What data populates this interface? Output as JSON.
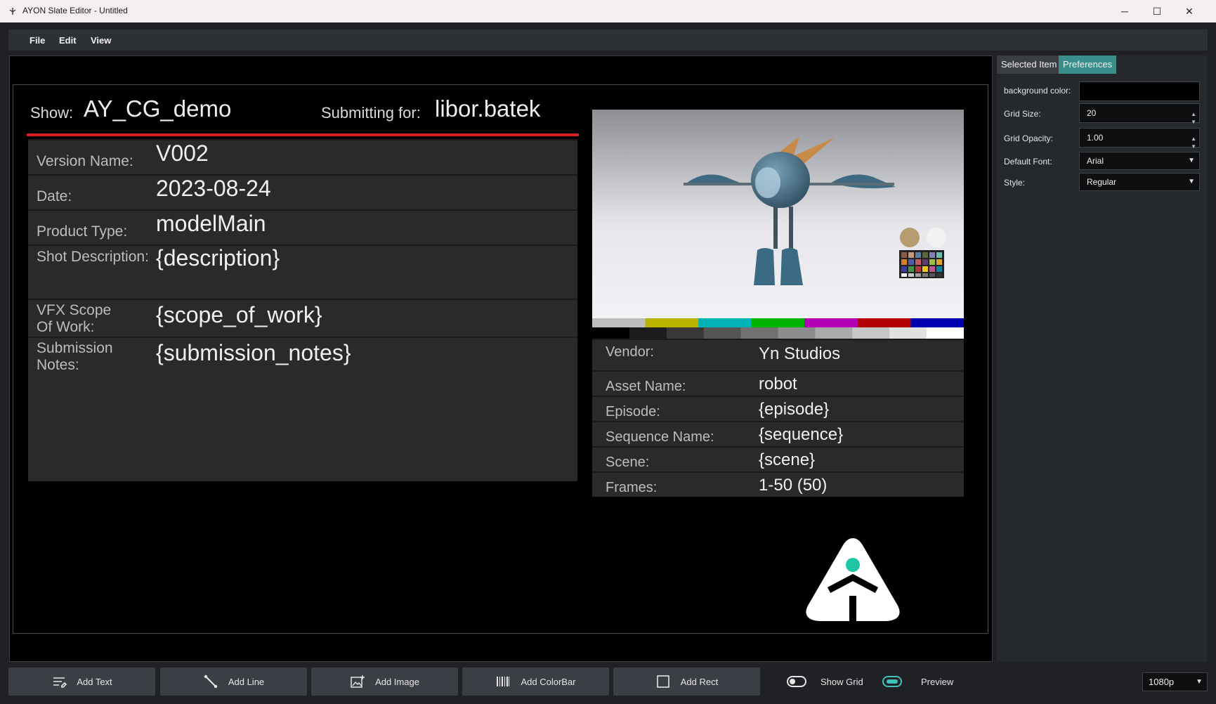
{
  "window": {
    "title": "AYON Slate Editor - Untitled",
    "minimize": "─",
    "maximize": "☐",
    "close": "✕"
  },
  "menu": [
    "File",
    "Edit",
    "View"
  ],
  "slate": {
    "show_label": "Show:",
    "show_value": "AY_CG_demo",
    "submitting_label": "Submitting for:",
    "submitting_value": "libor.batek",
    "left_rows": [
      {
        "label": "Version Name:",
        "value": "V002"
      },
      {
        "label": "Date:",
        "value": "2023-08-24"
      },
      {
        "label": "Product Type:",
        "value": "modelMain"
      },
      {
        "label": "Shot Description:",
        "value": "{description}"
      },
      {
        "label_line1": "VFX Scope",
        "label_line2": "Of Work:",
        "value": "{scope_of_work}"
      },
      {
        "label_line1": "Submission",
        "label_line2": "Notes:",
        "value": "{submission_notes}"
      }
    ],
    "right_rows": [
      {
        "label": "Vendor:",
        "value": "Yn Studios"
      },
      {
        "label": "Asset Name:",
        "value": "robot"
      },
      {
        "label": "Episode:",
        "value": "{episode}"
      },
      {
        "label": "Sequence Name:",
        "value": "{sequence}"
      },
      {
        "label": "Scene:",
        "value": "{scene}"
      },
      {
        "label": "Frames:",
        "value": "1-50 (50)"
      }
    ],
    "colorbar_top": [
      "#bdbdbd",
      "#b8b400",
      "#00b3b5",
      "#00b300",
      "#b300b5",
      "#b30000",
      "#0000b3"
    ],
    "colorbar_bottom": [
      "#000000",
      "#1c1c1c",
      "#383838",
      "#555555",
      "#717171",
      "#8d8d8d",
      "#aaaaaa",
      "#c6c6c6",
      "#e2e2e2",
      "#ffffff"
    ],
    "accent_red": "#d91f1f",
    "logo_accent": "#1ec6a3"
  },
  "panel": {
    "tabs": [
      "Selected Item",
      "Preferences"
    ],
    "background_color_label": "background color:",
    "background_color_value": "#000000",
    "grid_size_label": "Grid Size:",
    "grid_size_value": "20",
    "grid_opacity_label": "Grid Opacity:",
    "grid_opacity_value": "1.00",
    "default_font_label": "Default Font:",
    "default_font_value": "Arial",
    "style_label": "Style:",
    "style_value": "Regular",
    "tab_active_color": "#3a8f8a"
  },
  "toolbar": {
    "add_text": "Add Text",
    "add_line": "Add Line",
    "add_image": "Add Image",
    "add_colorbar": "Add ColorBar",
    "add_rect": "Add Rect",
    "show_grid": "Show Grid",
    "show_grid_on": false,
    "preview": "Preview",
    "preview_on": true,
    "resolution": "1080p"
  }
}
